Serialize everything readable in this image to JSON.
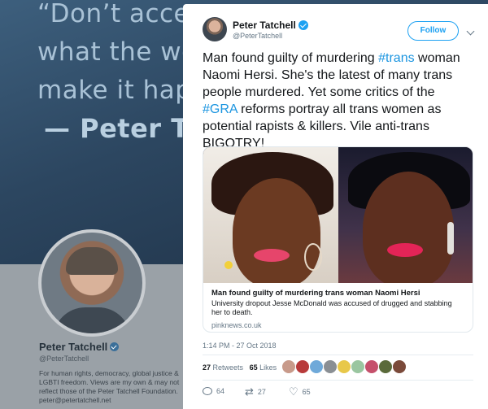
{
  "background": {
    "quote_lines": [
      "“Don’t accep",
      "what the wo",
      "make it happ",
      "— Peter T"
    ],
    "profile": {
      "name": "Peter Tatchell",
      "handle": "@PeterTatchell",
      "bio_lines": [
        "For human rights, democracy, global justice &",
        "LGBTI freedom. Views are my own & may not",
        "reflect those of the Peter Tatchell Foundation.",
        "peter@petertatchell.net"
      ]
    }
  },
  "tweet": {
    "author_name": "Peter Tatchell",
    "author_handle": "@PeterTatchell",
    "follow_label": "Follow",
    "text": {
      "p1": "Man found guilty of murdering ",
      "tag1": "#trans",
      "p2": " woman Naomi Hersi. She's the latest of many trans people murdered. Yet some critics of the ",
      "tag2": "#GRA",
      "p3": " reforms portray all trans women as potential rapists & killers. Vile anti-trans BIGOTRY!"
    },
    "link_card": {
      "title": "Man found guilty of murdering trans woman Naomi Hersi",
      "description": "University dropout Jesse McDonald was accused of drugged and stabbing her to death.",
      "domain": "pinknews.co.uk"
    },
    "timestamp": "1:14 PM - 27 Oct 2018",
    "stats": {
      "retweets": "27",
      "retweets_label": "Retweets",
      "likes": "65",
      "likes_label": "Likes"
    },
    "actions": {
      "replies": "64",
      "retweets": "27",
      "likes": "65"
    }
  },
  "colors": {
    "link": "#1b95e0",
    "accent": "#1da1f2",
    "muted": "#657786",
    "text": "#14171a"
  },
  "icons": [
    "verified-badge-icon",
    "chevron-down-icon",
    "reply-icon",
    "retweet-icon",
    "like-icon"
  ]
}
